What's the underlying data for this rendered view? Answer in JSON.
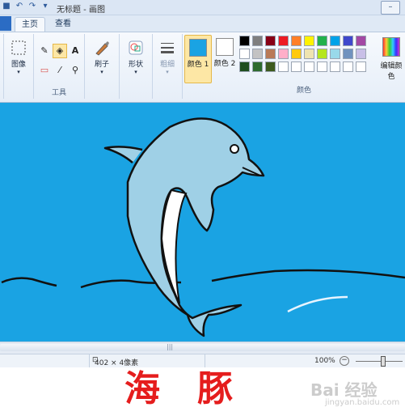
{
  "window": {
    "title": "无标题 - 画图"
  },
  "tabs": {
    "home": "主页",
    "view": "查看"
  },
  "ribbon": {
    "image_label": "图像",
    "tools_label": "工具",
    "text_tool": "A",
    "brushes_label": "刷子",
    "shapes_label": "形状",
    "size_label": "粗细",
    "color1_label": "颜色 1",
    "color2_label": "颜色 2",
    "colors_group_label": "颜色",
    "edit_colors_label": "编辑颜色",
    "color1_value": "#1aa3e3",
    "color2_value": "#ffffff",
    "palette": [
      "#000000",
      "#7f7f7f",
      "#880015",
      "#ed1c24",
      "#ff7f27",
      "#fff200",
      "#22b14c",
      "#00a2e8",
      "#3f48cc",
      "#a349a4",
      "#ffffff",
      "#c3c3c3",
      "#b97a57",
      "#ffaec9",
      "#ffc90e",
      "#efe4b0",
      "#b5e61d",
      "#99d9ea",
      "#7092be",
      "#c8bfe7",
      "#1f4e1f",
      "#2e6b2e",
      "#3d5a1e",
      "#ffffff",
      "#ffffff",
      "#ffffff",
      "#ffffff",
      "#ffffff",
      "#ffffff",
      "#ffffff"
    ]
  },
  "status": {
    "image_size": "402 × 4像素",
    "zoom": "100%",
    "zoom_out": "−"
  },
  "caption": "海豚",
  "watermark": {
    "main": "Bai 经验",
    "sub": "jingyan.baidu.com"
  }
}
